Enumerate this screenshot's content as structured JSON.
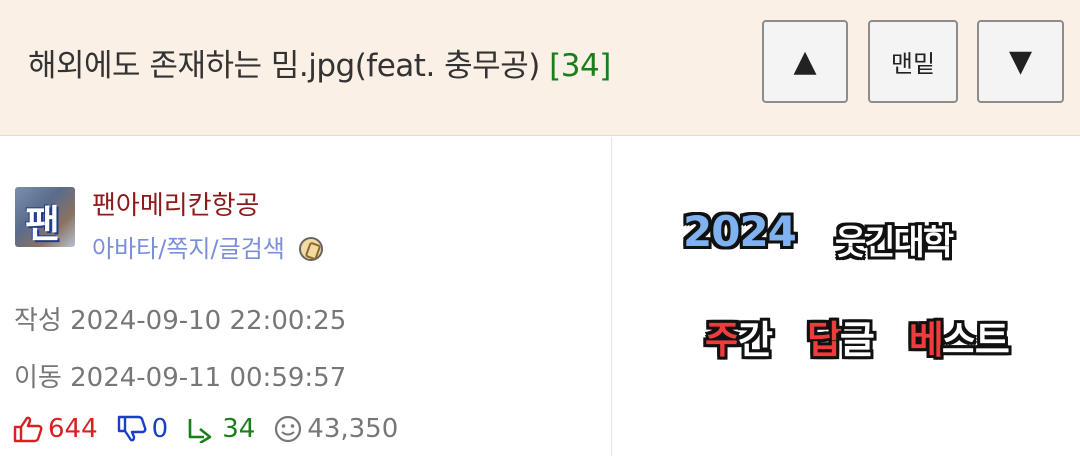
{
  "header": {
    "title": "해외에도 존재하는 밈.jpg(feat. 충무공)",
    "comment_count": "[34]",
    "up_symbol": "▲",
    "bottom_label": "맨밑",
    "down_symbol": "▼"
  },
  "author": {
    "avatar_text": "팬",
    "nickname": "팬아메리칸항공",
    "link_avatar": "아바타",
    "link_message": "쪽지",
    "link_search": "글검색",
    "link_separator": "/",
    "badge_icon": "badge-icon"
  },
  "post_meta": {
    "created_label": "작성",
    "created_at": "2024-09-10 22:00:25",
    "moved_label": "이동",
    "moved_at": "2024-09-11 00:59:57"
  },
  "stats": {
    "likes": "644",
    "dislikes": "0",
    "replies": "34",
    "views": "43,350"
  },
  "banner": {
    "year": "2024",
    "name": "웃긴대학",
    "weekly_1": "주",
    "weekly_2": "간",
    "weekly_3": "답",
    "weekly_4": "글",
    "weekly_5": "베",
    "weekly_6": "스",
    "weekly_7": "트"
  },
  "colors": {
    "header_bg": "#fbf0e6",
    "nickname": "#8b1a1a",
    "link": "#7b8ed8",
    "like": "#d82020",
    "dislike": "#1a3fc7",
    "reply": "#1a7f1a",
    "banner_blue": "#7fb2ee",
    "banner_red": "#ef3b3b"
  }
}
